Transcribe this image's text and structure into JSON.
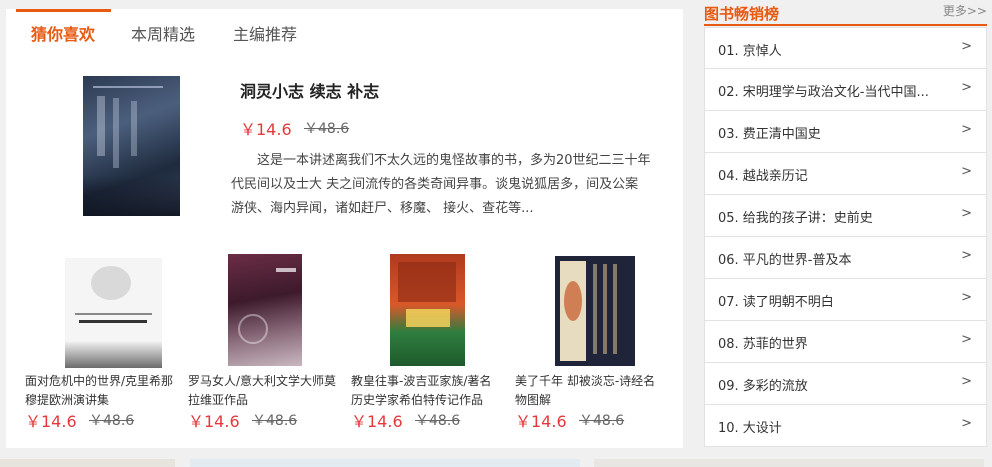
{
  "tabs": [
    {
      "label": "猜你喜欢",
      "active": true
    },
    {
      "label": "本周精选",
      "active": false
    },
    {
      "label": "主编推荐",
      "active": false
    }
  ],
  "featured": {
    "title": "洞灵小志 续志 补志",
    "price": "￥14.6",
    "old_price": "￥48.6",
    "description": "这是一本讲述离我们不太久远的鬼怪故事的书，多为20世纪二三十年代民间以及士大 夫之间流传的各类奇闻异事。谈鬼说狐居多，间及公案游侠、海内异闻，诸如赶尸、移魔、 接火、查花等..."
  },
  "books": [
    {
      "name": "面对危机中的世界/克里希那穆提欧洲演讲集",
      "price": "￥14.6",
      "old_price": "￥48.6"
    },
    {
      "name": "罗马女人/意大利文学大师莫拉维亚作品",
      "price": "￥14.6",
      "old_price": "￥48.6"
    },
    {
      "name": "教皇往事-波吉亚家族/著名历史学家希伯特传记作品",
      "price": "￥14.6",
      "old_price": "￥48.6"
    },
    {
      "name": "美了千年 却被淡忘-诗经名物图解",
      "price": "￥14.6",
      "old_price": "￥48.6"
    }
  ],
  "ranking": {
    "title": "图书畅销榜",
    "more": "更多>>",
    "items": [
      {
        "label": "01. 京悼人"
      },
      {
        "label": "02. 宋明理学与政治文化-当代中国..."
      },
      {
        "label": "03. 费正清中国史"
      },
      {
        "label": "04. 越战亲历记"
      },
      {
        "label": "05. 给我的孩子讲：史前史"
      },
      {
        "label": "06. 平凡的世界-普及本"
      },
      {
        "label": "07. 读了明朝不明白"
      },
      {
        "label": "08. 苏菲的世界"
      },
      {
        "label": "09. 多彩的流放"
      },
      {
        "label": "10. 大设计"
      }
    ],
    "arrow": ">"
  },
  "colors": {
    "accent": "#e85a12",
    "price": "#e4393c"
  },
  "icons": {
    "cover": "book-cover-image",
    "arrow": "chevron-right-icon"
  }
}
